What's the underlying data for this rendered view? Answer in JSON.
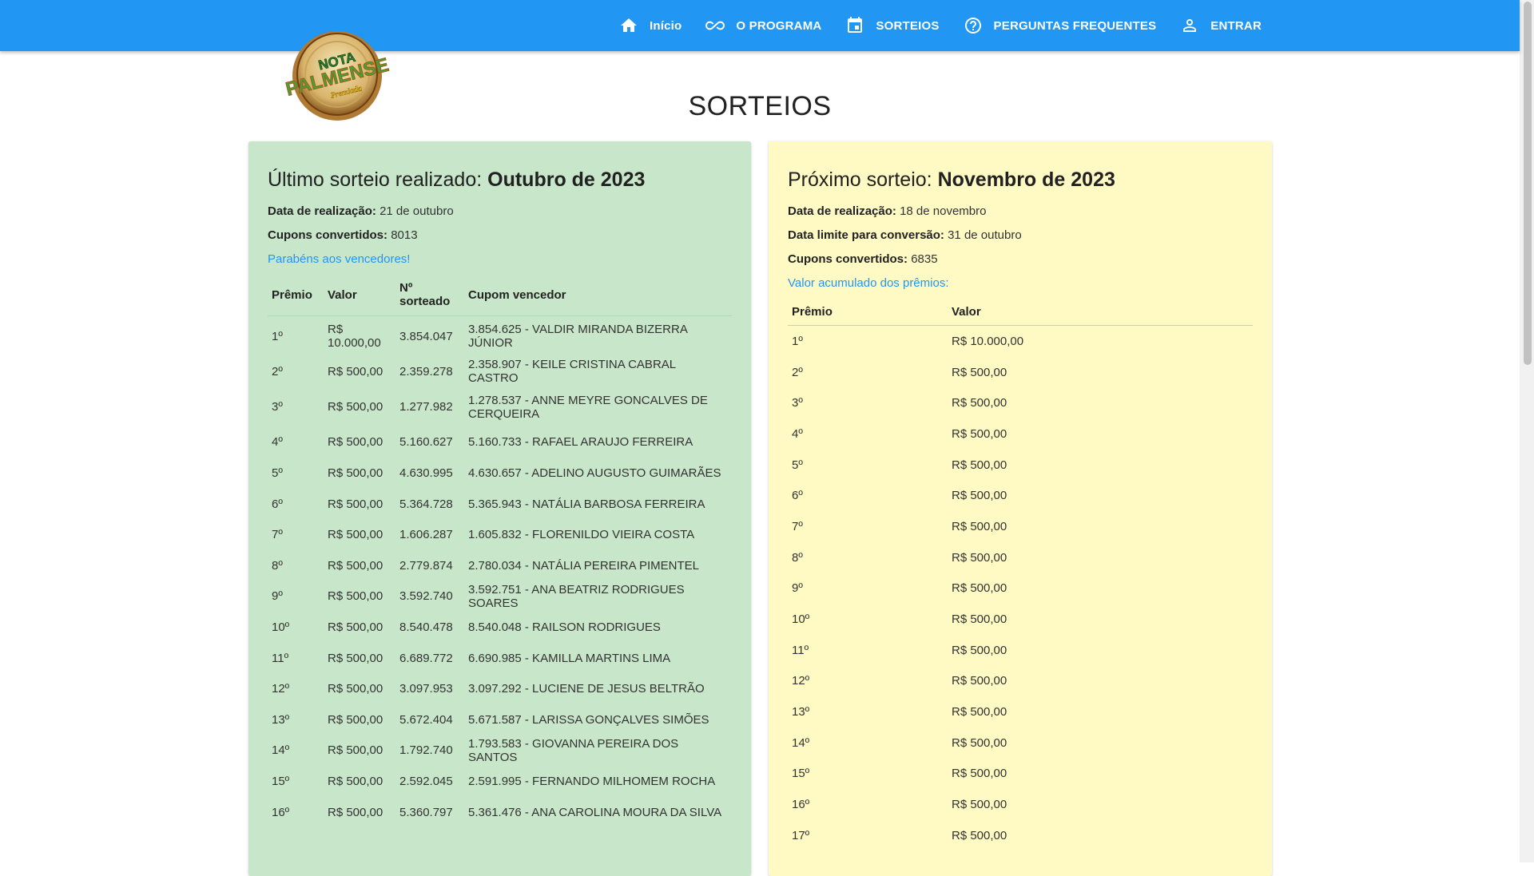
{
  "nav": {
    "items": [
      {
        "label": "Início",
        "icon": "home-icon"
      },
      {
        "label": "O PROGRAMA",
        "icon": "infinity-icon"
      },
      {
        "label": "SORTEIOS",
        "icon": "calendar-icon"
      },
      {
        "label": "PERGUNTAS FREQUENTES",
        "icon": "help-circle-icon"
      },
      {
        "label": "ENTRAR",
        "icon": "person-icon"
      }
    ]
  },
  "logo": {
    "line1": "NOTA",
    "line2": "PALMENSE",
    "line3": "Premiada"
  },
  "page_title": "SORTEIOS",
  "last_draw": {
    "title_prefix": "Último sorteio realizado: ",
    "title_bold": "Outubro de 2023",
    "date_label": "Data de realização:",
    "date_value": "21 de outubro",
    "coupons_label": "Cupons convertidos:",
    "coupons_value": "8013",
    "congrats": "Parabéns aos vencedores!",
    "headers": [
      "Prêmio",
      "Valor",
      "Nº sorteado",
      "Cupom vencedor"
    ],
    "rows": [
      {
        "prize": "1º",
        "value": "R$ 10.000,00",
        "number": "3.854.047",
        "winner": "3.854.625 - VALDIR MIRANDA BIZERRA JÚNIOR"
      },
      {
        "prize": "2º",
        "value": "R$ 500,00",
        "number": "2.359.278",
        "winner": "2.358.907 - KEILE CRISTINA CABRAL CASTRO"
      },
      {
        "prize": "3º",
        "value": "R$ 500,00",
        "number": "1.277.982",
        "winner": "1.278.537 - ANNE MEYRE GONCALVES DE CERQUEIRA"
      },
      {
        "prize": "4º",
        "value": "R$ 500,00",
        "number": "5.160.627",
        "winner": "5.160.733 - RAFAEL ARAUJO FERREIRA"
      },
      {
        "prize": "5º",
        "value": "R$ 500,00",
        "number": "4.630.995",
        "winner": "4.630.657 - ADELINO AUGUSTO GUIMARÃES"
      },
      {
        "prize": "6º",
        "value": "R$ 500,00",
        "number": "5.364.728",
        "winner": "5.365.943 - NATÁLIA BARBOSA FERREIRA"
      },
      {
        "prize": "7º",
        "value": "R$ 500,00",
        "number": "1.606.287",
        "winner": "1.605.832 - FLORENILDO VIEIRA COSTA"
      },
      {
        "prize": "8º",
        "value": "R$ 500,00",
        "number": "2.779.874",
        "winner": "2.780.034 - NATÁLIA PEREIRA PIMENTEL"
      },
      {
        "prize": "9º",
        "value": "R$ 500,00",
        "number": "3.592.740",
        "winner": "3.592.751 - ANA BEATRIZ RODRIGUES SOARES"
      },
      {
        "prize": "10º",
        "value": "R$ 500,00",
        "number": "8.540.478",
        "winner": "8.540.048 - RAILSON RODRIGUES"
      },
      {
        "prize": "11º",
        "value": "R$ 500,00",
        "number": "6.689.772",
        "winner": "6.690.985 - KAMILLA MARTINS LIMA"
      },
      {
        "prize": "12º",
        "value": "R$ 500,00",
        "number": "3.097.953",
        "winner": "3.097.292 - LUCIENE DE JESUS BELTRÃO"
      },
      {
        "prize": "13º",
        "value": "R$ 500,00",
        "number": "5.672.404",
        "winner": "5.671.587 - LARISSA GONÇALVES SIMÕES"
      },
      {
        "prize": "14º",
        "value": "R$ 500,00",
        "number": "1.792.740",
        "winner": "1.793.583 - GIOVANNA PEREIRA DOS SANTOS"
      },
      {
        "prize": "15º",
        "value": "R$ 500,00",
        "number": "2.592.045",
        "winner": "2.591.995 - FERNANDO MILHOMEM ROCHA"
      },
      {
        "prize": "16º",
        "value": "R$ 500,00",
        "number": "5.360.797",
        "winner": "5.361.476 - ANA CAROLINA MOURA DA SILVA"
      }
    ]
  },
  "next_draw": {
    "title_prefix": "Próximo sorteio: ",
    "title_bold": "Novembro de 2023",
    "date_label": "Data de realização:",
    "date_value": "18 de novembro",
    "deadline_label": "Data limite para conversão:",
    "deadline_value": "31 de outubro",
    "coupons_label": "Cupons convertidos:",
    "coupons_value": "6835",
    "accumulated": "Valor acumulado dos prêmios:",
    "headers": [
      "Prêmio",
      "Valor"
    ],
    "rows": [
      {
        "prize": "1º",
        "value": "R$ 10.000,00"
      },
      {
        "prize": "2º",
        "value": "R$ 500,00"
      },
      {
        "prize": "3º",
        "value": "R$ 500,00"
      },
      {
        "prize": "4º",
        "value": "R$ 500,00"
      },
      {
        "prize": "5º",
        "value": "R$ 500,00"
      },
      {
        "prize": "6º",
        "value": "R$ 500,00"
      },
      {
        "prize": "7º",
        "value": "R$ 500,00"
      },
      {
        "prize": "8º",
        "value": "R$ 500,00"
      },
      {
        "prize": "9º",
        "value": "R$ 500,00"
      },
      {
        "prize": "10º",
        "value": "R$ 500,00"
      },
      {
        "prize": "11º",
        "value": "R$ 500,00"
      },
      {
        "prize": "12º",
        "value": "R$ 500,00"
      },
      {
        "prize": "13º",
        "value": "R$ 500,00"
      },
      {
        "prize": "14º",
        "value": "R$ 500,00"
      },
      {
        "prize": "15º",
        "value": "R$ 500,00"
      },
      {
        "prize": "16º",
        "value": "R$ 500,00"
      },
      {
        "prize": "17º",
        "value": "R$ 500,00"
      }
    ]
  }
}
